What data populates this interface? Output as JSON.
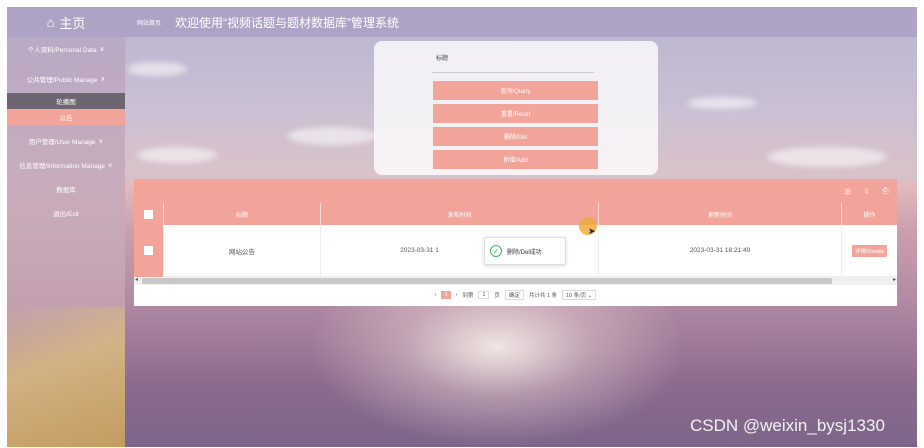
{
  "sidebar": {
    "home": "主页",
    "items": [
      {
        "label": "个人资料/Personal Data",
        "chevron": "∨"
      },
      {
        "label": "公共管理/Public Manage",
        "chevron": "∧"
      },
      {
        "label": "用户管理/User Manage",
        "chevron": "∨"
      },
      {
        "label": "信息管理/Information Manage",
        "chevron": "∨"
      },
      {
        "label": "数据库"
      },
      {
        "label": "退出/Exit"
      }
    ],
    "subitems": [
      "轮播图",
      "公告"
    ]
  },
  "topbar": {
    "link": "网站首页",
    "title": "欢迎使用“视频话题与题材数据库”管理系统"
  },
  "search": {
    "label": "标题",
    "placeholder": "",
    "buttons": [
      "查询/Query",
      "重置/Reset",
      "删除/Del",
      "新增/Add"
    ]
  },
  "table": {
    "tools": [
      "⊞",
      "⇩",
      "⎙"
    ],
    "headers": [
      "标题",
      "发布时间",
      "更新时间",
      "操作"
    ],
    "rows": [
      {
        "title": "网站公告",
        "published": "2023-03-31 1",
        "updated": "2023-03-31 18:21:49",
        "action": "详情/Details"
      }
    ]
  },
  "pager": {
    "prev": "‹",
    "page": "1",
    "next": "›",
    "goto": "到第",
    "goto_value": "1",
    "page_unit": "页",
    "confirm": "确定",
    "total": "共计共 1 条",
    "page_size": "10 条/页"
  },
  "toast": {
    "text": "删除/Del成功"
  },
  "watermark": "CSDN @weixin_bysj1330",
  "colors": {
    "accent": "#f2a39a",
    "header": "#aea3c5",
    "success": "#3fb86b"
  }
}
